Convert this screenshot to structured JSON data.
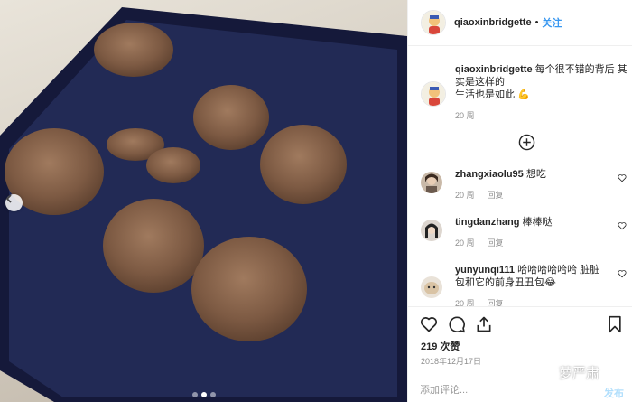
{
  "post": {
    "username": "qiaoxinbridgette",
    "separator": "•",
    "follow_label": "关注"
  },
  "caption": {
    "username": "qiaoxinbridgette",
    "text_line1": " 每个很不错的背后 其实是这样的",
    "text_line2": "生活也是如此 💪",
    "time": "20 周"
  },
  "comments": [
    {
      "username": "zhangxiaolu95",
      "text": " 想吃",
      "time": "20 周",
      "reply": "回复"
    },
    {
      "username": "tingdanzhang",
      "text": " 棒棒哒",
      "time": "20 周",
      "reply": "回复"
    },
    {
      "username": "yunyunqi111",
      "text": " 哈哈哈哈哈哈 脏脏包和它的前身丑丑包😂",
      "time": "20 周",
      "reply": "回复"
    }
  ],
  "actions": {
    "likes": "219 次赞",
    "date": "2018年12月17日",
    "comment_placeholder": "添加评论...",
    "post_label": "发布"
  },
  "watermark": {
    "text": "萝严肃"
  },
  "icons": [
    "chevron-left-icon",
    "plus-circle-icon",
    "heart-icon",
    "comment-icon",
    "share-icon",
    "bookmark-icon"
  ]
}
